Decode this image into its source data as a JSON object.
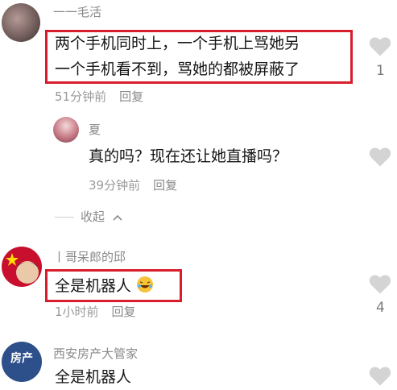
{
  "comments": [
    {
      "name": "一一毛活",
      "text_line1": "两个手机同时上，一个手机上骂她另",
      "text_line2": "一个手机看不到，骂她的都被屏蔽了",
      "time": "51分钟前",
      "reply": "回复",
      "likes": "1"
    },
    {
      "name": "夏",
      "text": "真的吗？现在还让她直播吗？",
      "time": "39分钟前",
      "reply": "回复"
    },
    {
      "name": "丨哥呆郎的邱",
      "text": "全是机器人",
      "time": "1小时前",
      "reply": "回复",
      "likes": "4"
    },
    {
      "name": "西安房产大管家",
      "text": "全是机器人",
      "avatar_text": "房产"
    }
  ],
  "collapse_label": "收起",
  "colors": {
    "highlight": "#d81e2c",
    "heart": "#d4d4d4"
  }
}
